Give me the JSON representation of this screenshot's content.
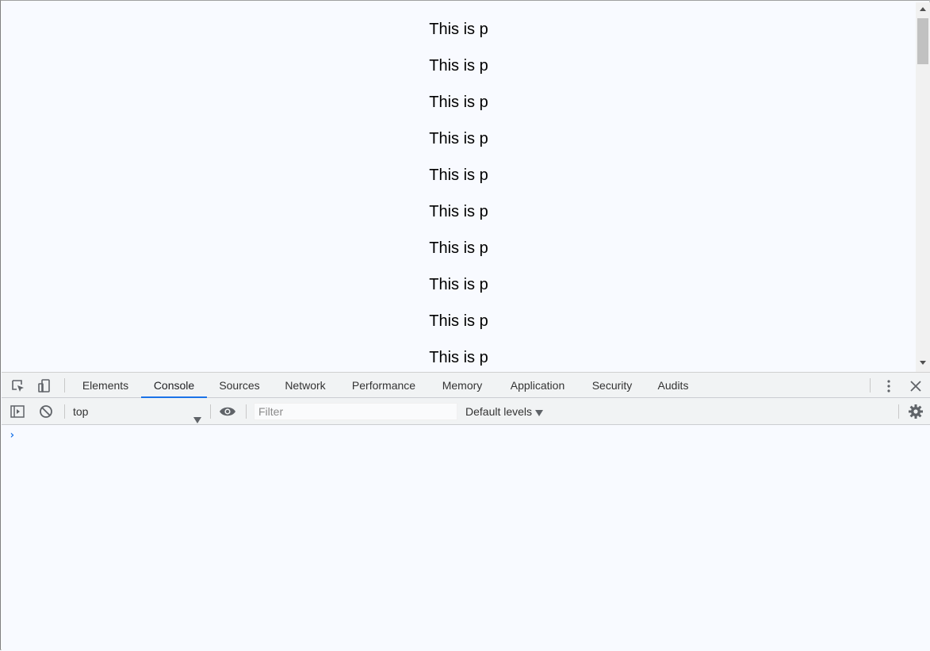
{
  "page": {
    "paragraphs": [
      "This is p",
      "This is p",
      "This is p",
      "This is p",
      "This is p",
      "This is p",
      "This is p",
      "This is p",
      "This is p",
      "This is p"
    ]
  },
  "devtools": {
    "icons": {
      "inspect": "inspect-element-icon",
      "device": "device-toolbar-icon",
      "more": "more-vertical-icon",
      "close": "close-icon"
    },
    "tabs": [
      {
        "label": "Elements",
        "active": false
      },
      {
        "label": "Console",
        "active": true
      },
      {
        "label": "Sources",
        "active": false
      },
      {
        "label": "Network",
        "active": false
      },
      {
        "label": "Performance",
        "active": false
      },
      {
        "label": "Memory",
        "active": false
      },
      {
        "label": "Application",
        "active": false
      },
      {
        "label": "Security",
        "active": false
      },
      {
        "label": "Audits",
        "active": false
      }
    ],
    "toolbar": {
      "context": "top",
      "filter_placeholder": "Filter",
      "filter_value": "",
      "levels": "Default levels"
    },
    "console": {
      "prompt": "›"
    },
    "accent_color": "#1a73e8"
  }
}
